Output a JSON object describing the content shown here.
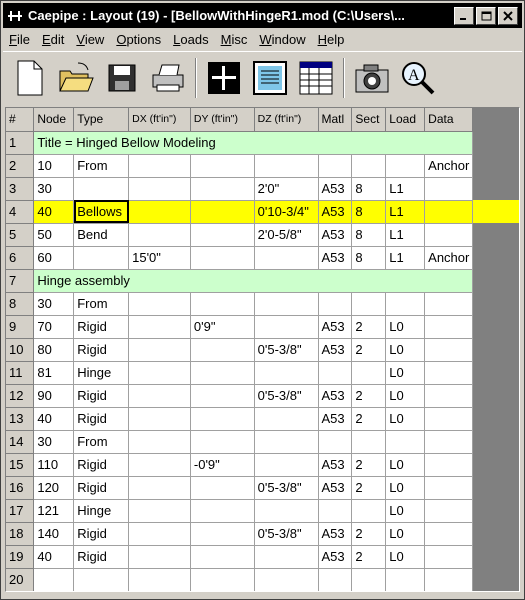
{
  "window": {
    "title": "Caepipe : Layout  (19) - [BellowWithHingeR1.mod (C:\\Users\\...",
    "controls": [
      "minimize",
      "maximize",
      "close"
    ]
  },
  "menu": [
    {
      "label": "File",
      "u": "F",
      "rest": "ile"
    },
    {
      "label": "Edit",
      "u": "E",
      "rest": "dit"
    },
    {
      "label": "View",
      "u": "V",
      "rest": "iew"
    },
    {
      "label": "Options",
      "u": "O",
      "rest": "ptions"
    },
    {
      "label": "Loads",
      "u": "L",
      "rest": "oads"
    },
    {
      "label": "Misc",
      "u": "M",
      "rest": "isc"
    },
    {
      "label": "Window",
      "u": "W",
      "rest": "indow"
    },
    {
      "label": "Help",
      "u": "H",
      "rest": "elp"
    }
  ],
  "toolbar": [
    "new-file-icon",
    "open-folder-icon",
    "save-disk-icon",
    "print-icon",
    "layout-cross-icon",
    "text-list-icon",
    "spreadsheet-icon",
    "camera-icon",
    "zoom-search-icon"
  ],
  "grid": {
    "headers": [
      "#",
      "Node",
      "Type",
      "DX (ft'in\")",
      "DY (ft'in\")",
      "DZ (ft'in\")",
      "Matl",
      "Sect",
      "Load",
      "Data"
    ],
    "rows": [
      {
        "n": "1",
        "span": "Title = Hinged Bellow Modeling"
      },
      {
        "n": "2",
        "c": [
          "10",
          "From",
          "",
          "",
          "",
          "",
          "",
          "",
          "Anchor"
        ]
      },
      {
        "n": "3",
        "c": [
          "30",
          "",
          "",
          "",
          "2'0\"",
          "A53",
          "8",
          "L1",
          ""
        ]
      },
      {
        "n": "4",
        "c": [
          "40",
          "Bellows",
          "",
          "",
          "0'10-3/4\"",
          "A53",
          "8",
          "L1",
          ""
        ],
        "selected": true
      },
      {
        "n": "5",
        "c": [
          "50",
          "Bend",
          "",
          "",
          "2'0-5/8\"",
          "A53",
          "8",
          "L1",
          ""
        ]
      },
      {
        "n": "6",
        "c": [
          "60",
          "",
          "15'0\"",
          "",
          "",
          "A53",
          "8",
          "L1",
          "Anchor"
        ]
      },
      {
        "n": "7",
        "span": "Hinge assembly"
      },
      {
        "n": "8",
        "c": [
          "30",
          "From",
          "",
          "",
          "",
          "",
          "",
          "",
          ""
        ]
      },
      {
        "n": "9",
        "c": [
          "70",
          "Rigid",
          "",
          "0'9\"",
          "",
          "A53",
          "2",
          "L0",
          ""
        ]
      },
      {
        "n": "10",
        "c": [
          "80",
          "Rigid",
          "",
          "",
          "0'5-3/8\"",
          "A53",
          "2",
          "L0",
          ""
        ]
      },
      {
        "n": "11",
        "c": [
          "81",
          "Hinge",
          "",
          "",
          "",
          "",
          "",
          "L0",
          ""
        ]
      },
      {
        "n": "12",
        "c": [
          "90",
          "Rigid",
          "",
          "",
          "0'5-3/8\"",
          "A53",
          "2",
          "L0",
          ""
        ]
      },
      {
        "n": "13",
        "c": [
          "40",
          "Rigid",
          "",
          "",
          "",
          "A53",
          "2",
          "L0",
          ""
        ]
      },
      {
        "n": "14",
        "c": [
          "30",
          "From",
          "",
          "",
          "",
          "",
          "",
          "",
          ""
        ]
      },
      {
        "n": "15",
        "c": [
          "110",
          "Rigid",
          "",
          "-0'9\"",
          "",
          "A53",
          "2",
          "L0",
          ""
        ]
      },
      {
        "n": "16",
        "c": [
          "120",
          "Rigid",
          "",
          "",
          "0'5-3/8\"",
          "A53",
          "2",
          "L0",
          ""
        ]
      },
      {
        "n": "17",
        "c": [
          "121",
          "Hinge",
          "",
          "",
          "",
          "",
          "",
          "L0",
          ""
        ]
      },
      {
        "n": "18",
        "c": [
          "140",
          "Rigid",
          "",
          "",
          "0'5-3/8\"",
          "A53",
          "2",
          "L0",
          ""
        ]
      },
      {
        "n": "19",
        "c": [
          "40",
          "Rigid",
          "",
          "",
          "",
          "A53",
          "2",
          "L0",
          ""
        ]
      },
      {
        "n": "20",
        "c": [
          "",
          "",
          "",
          "",
          "",
          "",
          "",
          "",
          ""
        ]
      }
    ]
  }
}
